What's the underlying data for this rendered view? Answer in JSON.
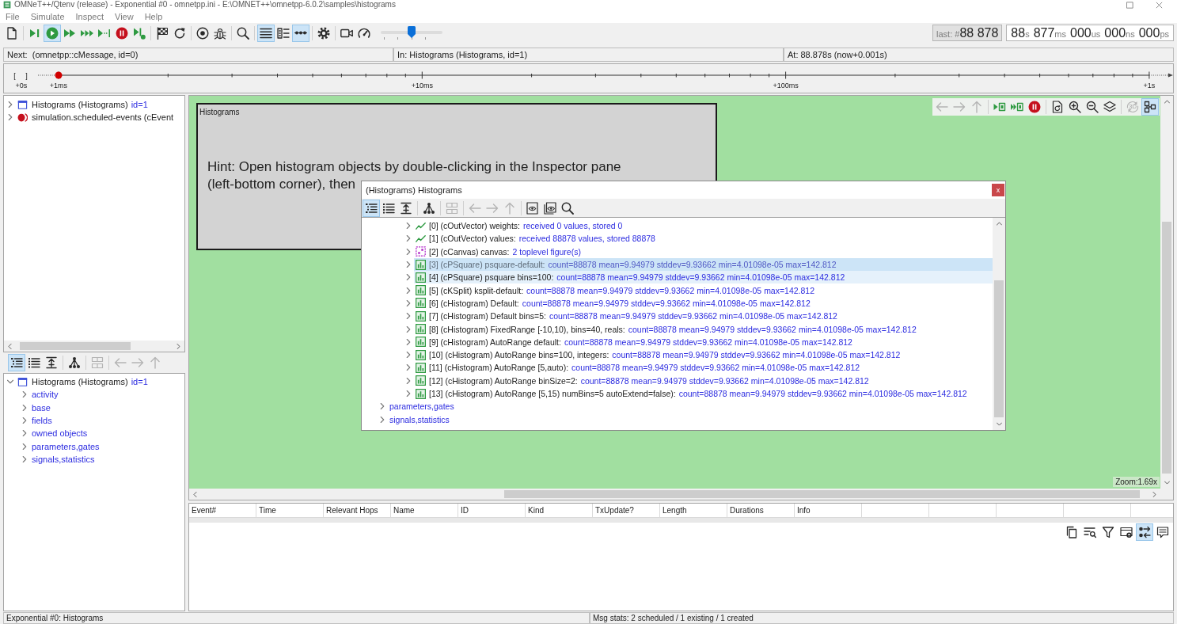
{
  "window": {
    "title": "OMNeT++/Qtenv (release) - Exponential #0 - omnetpp.ini - E:\\OMNET++\\omnetpp-6.0.2\\samples\\histograms"
  },
  "menu": [
    "File",
    "Simulate",
    "Inspect",
    "View",
    "Help"
  ],
  "toolbar": {
    "buttons": [
      {
        "on": false
      },
      {
        "on": false
      },
      {
        "on": true
      },
      {
        "on": false
      },
      {
        "on": false
      },
      {
        "on": false
      },
      {
        "on": false
      },
      {
        "on": false
      },
      {
        "on": false
      },
      {
        "on": false
      },
      {
        "on": false
      },
      {
        "on": false
      },
      {
        "on": false
      },
      {
        "on": true
      },
      {
        "on": false
      },
      {
        "on": true
      },
      {
        "on": false
      },
      {
        "on": false
      },
      {
        "on": false
      }
    ],
    "speed": {
      "level": 0.5
    }
  },
  "event_counter": {
    "label": "last: #",
    "value": "88 878"
  },
  "sim_time": [
    {
      "value": "88",
      "unit": "s"
    },
    {
      "value": "877",
      "unit": "ms"
    },
    {
      "value": "000",
      "unit": "us"
    },
    {
      "value": "000",
      "unit": "ns"
    },
    {
      "value": "000",
      "unit": "ps"
    }
  ],
  "status_line": [
    "Next:  (omnetpp::cMessage, id=0)",
    "In: Histograms (Histograms, id=1)",
    "At: 88.878s (now+0.001s)"
  ],
  "timeline": {
    "bracket": "[ ]",
    "start_label": "+0s",
    "decade_labels": [
      "+1ms",
      "+10ms",
      "+100ms",
      "+1s"
    ]
  },
  "object_tree": {
    "items": [
      {
        "kind": "module",
        "label": "Histograms (Histograms)",
        "id": "id=1",
        "expanded": false
      },
      {
        "kind": "queue",
        "label": "simulation.scheduled-events (cEvent",
        "expanded": false
      }
    ]
  },
  "inspector": {
    "toolbar": [
      {
        "on": true,
        "disabled": false
      },
      {
        "on": false,
        "disabled": false
      },
      {
        "on": false,
        "disabled": false
      },
      {
        "on": false,
        "disabled": false
      },
      {
        "on": false,
        "disabled": true
      },
      {
        "on": false,
        "disabled": true
      },
      {
        "on": false,
        "disabled": true
      },
      {
        "on": false,
        "disabled": true
      }
    ],
    "tree": [
      {
        "kind": "module",
        "label": "Histograms (Histograms)",
        "id": "id=1",
        "expanded": true,
        "children": [
          {
            "kind": "group",
            "label": "activity",
            "expanded": false
          },
          {
            "kind": "group",
            "label": "base",
            "expanded": false
          },
          {
            "kind": "group",
            "label": "fields",
            "expanded": false
          },
          {
            "kind": "group",
            "label": "owned objects",
            "expanded": false
          },
          {
            "kind": "group",
            "label": "parameters,gates",
            "expanded": false
          },
          {
            "kind": "group",
            "label": "signals,statistics",
            "expanded": false
          }
        ]
      }
    ]
  },
  "canvas": {
    "toolbar": [
      {
        "on": false,
        "disabled": true
      },
      {
        "on": false,
        "disabled": true
      },
      {
        "on": false,
        "disabled": true
      },
      {
        "on": false,
        "disabled": false
      },
      {
        "on": false,
        "disabled": false
      },
      {
        "on": false,
        "disabled": false
      },
      {
        "on": false,
        "disabled": false
      },
      {
        "on": false,
        "disabled": false
      },
      {
        "on": false,
        "disabled": false
      },
      {
        "on": false,
        "disabled": false
      },
      {
        "on": false,
        "disabled": true,
        "label": "3D"
      },
      {
        "on": true,
        "disabled": false
      }
    ],
    "module": {
      "title": "Histograms",
      "hint": [
        "Hint: Open histogram objects by double-clicking in the Inspector pane",
        "(left-bottom corner), then"
      ]
    },
    "zoom": "Zoom:1.69x"
  },
  "dialog": {
    "title": "(Histograms) Histograms",
    "close": "x",
    "toolbar": [
      {
        "on": true,
        "disabled": false
      },
      {
        "on": false,
        "disabled": false
      },
      {
        "on": false,
        "disabled": false
      },
      {
        "on": false,
        "disabled": false
      },
      {
        "on": false,
        "disabled": true
      },
      {
        "on": false,
        "disabled": true
      },
      {
        "on": false,
        "disabled": true
      },
      {
        "on": false,
        "disabled": true
      },
      {
        "on": false,
        "disabled": false
      },
      {
        "on": false,
        "disabled": false
      },
      {
        "on": false,
        "disabled": false
      }
    ],
    "rows": [
      {
        "children": [
          {
            "kind": "vector",
            "label": "[0] (cOutVector) weights:",
            "info": "received 0 values, stored 0",
            "expanded": false,
            "selected": false,
            "hovered": false
          },
          {
            "kind": "vector",
            "label": "[1] (cOutVector) values:",
            "info": "received 88878 values, stored 88878",
            "expanded": false,
            "selected": false,
            "hovered": false
          },
          {
            "kind": "canvas",
            "label": "[2] (cCanvas) canvas:",
            "info": "2 toplevel figure(s)",
            "expanded": false,
            "selected": false,
            "hovered": false
          },
          {
            "kind": "histogram",
            "label": "[3] (cPSquare) psquare-default:",
            "info": "count=88878 mean=9.94979 stddev=9.93662 min=4.01098e-05 max=142.812",
            "expanded": false,
            "selected": true,
            "hovered": false
          },
          {
            "kind": "histogram",
            "label": "[4] (cPSquare) psquare bins=100:",
            "info": "count=88878 mean=9.94979 stddev=9.93662 min=4.01098e-05 max=142.812",
            "expanded": false,
            "selected": false,
            "hovered": true
          },
          {
            "kind": "histogram",
            "label": "[5] (cKSplit) ksplit-default:",
            "info": "count=88878 mean=9.94979 stddev=9.93662 min=4.01098e-05 max=142.812",
            "expanded": false,
            "selected": false,
            "hovered": false
          },
          {
            "kind": "histogram",
            "label": "[6] (cHistogram) Default:",
            "info": "count=88878 mean=9.94979 stddev=9.93662 min=4.01098e-05 max=142.812",
            "expanded": false,
            "selected": false,
            "hovered": false
          },
          {
            "kind": "histogram",
            "label": "[7] (cHistogram) Default bins=5:",
            "info": "count=88878 mean=9.94979 stddev=9.93662 min=4.01098e-05 max=142.812",
            "expanded": false,
            "selected": false,
            "hovered": false
          },
          {
            "kind": "histogram",
            "label": "[8] (cHistogram) FixedRange [-10,10), bins=40, reals:",
            "info": "count=88878 mean=9.94979 stddev=9.93662 min=4.01098e-05 max=142.812",
            "expanded": false,
            "selected": false,
            "hovered": false
          },
          {
            "kind": "histogram",
            "label": "[9] (cHistogram) AutoRange default:",
            "info": "count=88878 mean=9.94979 stddev=9.93662 min=4.01098e-05 max=142.812",
            "expanded": false,
            "selected": false,
            "hovered": false
          },
          {
            "kind": "histogram",
            "label": "[10] (cHistogram) AutoRange bins=100, integers:",
            "info": "count=88878 mean=9.94979 stddev=9.93662 min=4.01098e-05 max=142.812",
            "expanded": false,
            "selected": false,
            "hovered": false
          },
          {
            "kind": "histogram",
            "label": "[11] (cHistogram) AutoRange [5,auto):",
            "info": "count=88878 mean=9.94979 stddev=9.93662 min=4.01098e-05 max=142.812",
            "expanded": false,
            "selected": false,
            "hovered": false
          },
          {
            "kind": "histogram",
            "label": "[12] (cHistogram) AutoRange binSize=2:",
            "info": "count=88878 mean=9.94979 stddev=9.93662 min=4.01098e-05 max=142.812",
            "expanded": false,
            "selected": false,
            "hovered": false
          },
          {
            "kind": "histogram",
            "label": "[13] (cHistogram) AutoRange [5,15) numBins=5 autoExtend=false):",
            "info": "count=88878 mean=9.94979 stddev=9.93662 min=4.01098e-05 max=142.812",
            "expanded": false,
            "selected": false,
            "hovered": false
          }
        ]
      },
      {
        "kind": "group",
        "label": "parameters,gates",
        "expanded": false,
        "selected": false,
        "hovered": false
      },
      {
        "kind": "group",
        "label": "signals,statistics",
        "expanded": false,
        "selected": false,
        "hovered": false
      }
    ]
  },
  "message_log": {
    "columns": [
      "Event#",
      "Time",
      "Relevant Hops",
      "Name",
      "ID",
      "Kind",
      "TxUpdate?",
      "Length",
      "Durations",
      "Info"
    ],
    "toolbar": [
      {
        "on": false
      },
      {
        "on": false
      },
      {
        "on": false
      },
      {
        "on": false
      },
      {
        "on": true
      },
      {
        "on": false
      }
    ]
  },
  "status_bar": [
    "Exponential #0: Histograms",
    "Msg stats: 2 scheduled / 1 existing / 1 created"
  ]
}
